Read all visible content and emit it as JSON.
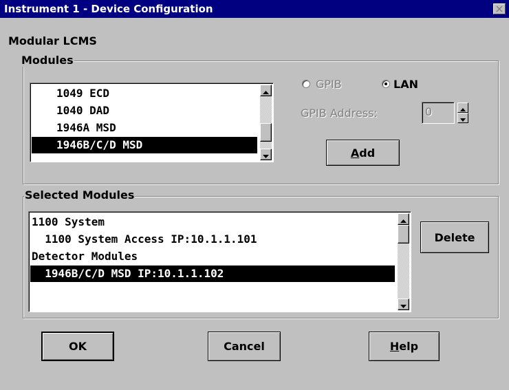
{
  "window": {
    "title": "Instrument 1 - Device Configuration",
    "close_icon": "close-icon"
  },
  "instrument_label": "Modular LCMS",
  "modules_group": {
    "legend": "Modules",
    "items": [
      {
        "label": "1049 ECD",
        "selected": false
      },
      {
        "label": "1040 DAD",
        "selected": false
      },
      {
        "label": "1946A MSD",
        "selected": false
      },
      {
        "label": "1946B/C/D MSD",
        "selected": true
      }
    ],
    "connection": {
      "gpib_label": "GPIB",
      "lan_label": "LAN",
      "selected": "LAN"
    },
    "gpib_address_label": "GPIB Address:",
    "gpib_address_value": "0",
    "add_button": {
      "before": "",
      "accel": "A",
      "after": "dd"
    }
  },
  "selected_group": {
    "legend": "Selected Modules",
    "items": [
      {
        "label": "1100 System",
        "selected": false
      },
      {
        "label": "  1100 System Access IP:10.1.1.101",
        "selected": false
      },
      {
        "label": "Detector Modules",
        "selected": false
      },
      {
        "label": "  1946B/C/D MSD IP:10.1.1.102",
        "selected": true
      }
    ],
    "delete_label": "Delete"
  },
  "footer": {
    "ok_label": "OK",
    "cancel_label": "Cancel",
    "help_button": {
      "accel": "H",
      "after": "elp"
    }
  },
  "colors": {
    "titlebar": "#000080",
    "dialog": "#c0c0c0",
    "selection": "#000000"
  }
}
